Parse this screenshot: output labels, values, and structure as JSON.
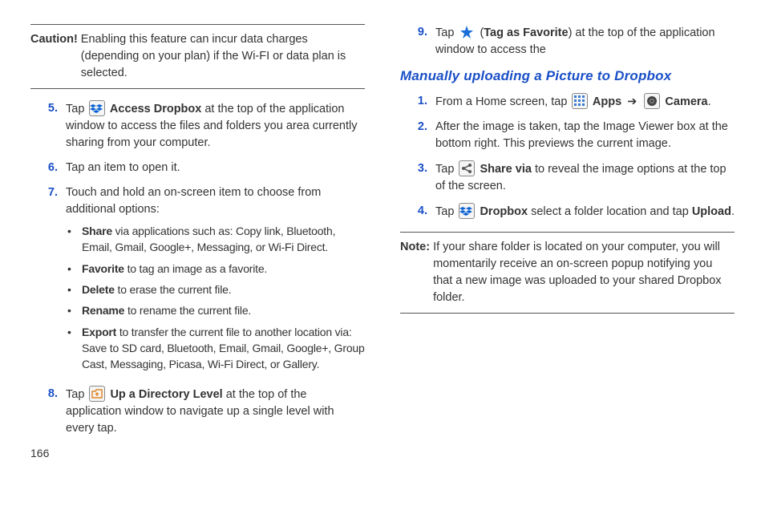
{
  "pageNumber": "166",
  "left": {
    "cautionLabel": "Caution!",
    "cautionText": "Enabling this feature can incur data charges (depending on your plan) if the Wi-FI or data plan is selected.",
    "step5": {
      "num": "5.",
      "pre": "Tap ",
      "bold": " Access Dropbox",
      "post": " at the top of the application window to access the files and folders you area currently sharing from your computer."
    },
    "step6": {
      "num": "6.",
      "text": "Tap an item to open it."
    },
    "step7": {
      "num": "7.",
      "text": "Touch and hold an on-screen item to choose from additional options:",
      "bullets": [
        {
          "bold": "Share",
          "rest": " via applications such as: Copy link, Bluetooth, Email, Gmail, Google+, Messaging, or Wi-Fi Direct."
        },
        {
          "bold": "Favorite",
          "rest": " to tag an image as a favorite."
        },
        {
          "bold": "Delete",
          "rest": " to erase the current file."
        },
        {
          "bold": "Rename",
          "rest": " to rename the current file."
        },
        {
          "bold": "Export",
          "rest": " to transfer the current file to another location via: Save to SD card, Bluetooth, Email, Gmail, Google+, Group Cast, Messaging, Picasa, Wi-Fi Direct, or Gallery."
        }
      ]
    },
    "step8": {
      "num": "8.",
      "pre": "Tap ",
      "bold": " Up a Directory Level",
      "post": " at the top of the application window to navigate up a single level with every tap."
    }
  },
  "right": {
    "step9": {
      "num": "9.",
      "pre": "Tap ",
      "mid1": " (",
      "bold": "Tag as Favorite",
      "mid2": ") at the top of the application window to access the"
    },
    "sectionHeading": "Manually uploading a Picture to Dropbox",
    "step1": {
      "num": "1.",
      "pre": "From a Home screen, tap ",
      "apps": " Apps",
      "arrow": " ➔ ",
      "camera": " Camera",
      "end": "."
    },
    "step2": {
      "num": "2.",
      "text": "After the image is taken, tap the Image Viewer box at the bottom right. This previews the current image."
    },
    "step3": {
      "num": "3.",
      "pre": "Tap ",
      "bold": " Share via",
      "post": " to reveal the image options at the top of the screen."
    },
    "step4": {
      "num": "4.",
      "pre": "Tap ",
      "bold": " Dropbox",
      "mid": " select a folder location and tap ",
      "bold2": "Upload",
      "end": "."
    },
    "noteLabel": "Note:",
    "noteText": "If your share folder is located on your computer, you will momentarily receive an on-screen popup notifying you that a new image was uploaded to your shared Dropbox folder."
  }
}
